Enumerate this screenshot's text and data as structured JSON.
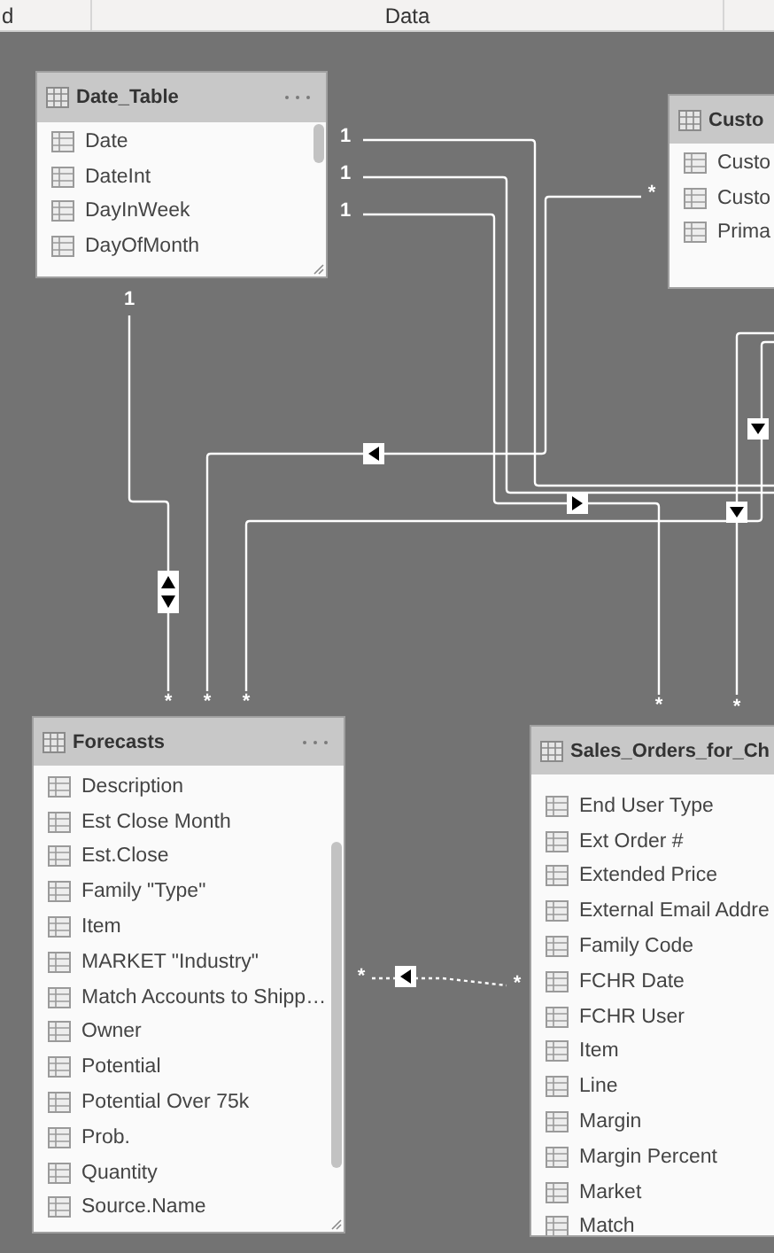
{
  "top_bar": {
    "left_tab": "d",
    "center_tab": "Data"
  },
  "tables": [
    {
      "name": "Date_Table",
      "fields": [
        "Date",
        "DateInt",
        "DayInWeek",
        "DayOfMonth"
      ],
      "scrollbar": true
    },
    {
      "name": "Custo",
      "fields": [
        "Custo",
        "Custo",
        "Prima"
      ],
      "scrollbar": false
    },
    {
      "name": "Forecasts",
      "fields": [
        "Description",
        "Est Close Month",
        "Est.Close",
        "Family \"Type\"",
        "Item",
        "MARKET \"Industry\"",
        "Match Accounts to Shipp…",
        "Owner",
        "Potential",
        "Potential Over 75k",
        "Prob.",
        "Quantity",
        "Source.Name"
      ],
      "scrollbar": true
    },
    {
      "name": "Sales_Orders_for_Ch",
      "fields": [
        "End User Type",
        "Ext Order #",
        "Extended Price",
        "External Email Addre",
        "Family Code",
        "FCHR Date",
        "FCHR User",
        "Item",
        "Line",
        "Margin",
        "Margin Percent",
        "Market",
        "Match"
      ],
      "scrollbar": false
    }
  ],
  "relationships": [
    {
      "end_a": "1",
      "end_b": "*",
      "kind": "both",
      "active": true
    },
    {
      "end_a": "*",
      "end_b": "*",
      "kind": "single",
      "active": true
    },
    {
      "end_b": "*",
      "kind": "single",
      "active": true
    },
    {
      "end_a": "1",
      "kind": "plain",
      "active": true
    },
    {
      "end_a": "1",
      "kind": "plain",
      "active": true
    },
    {
      "end_a": "1",
      "end_b": "*",
      "kind": "single",
      "active": true
    },
    {
      "end_b": "*",
      "kind": "single",
      "active": true
    },
    {
      "end_a": "*",
      "end_b": "*",
      "kind": "single",
      "active": false
    }
  ]
}
